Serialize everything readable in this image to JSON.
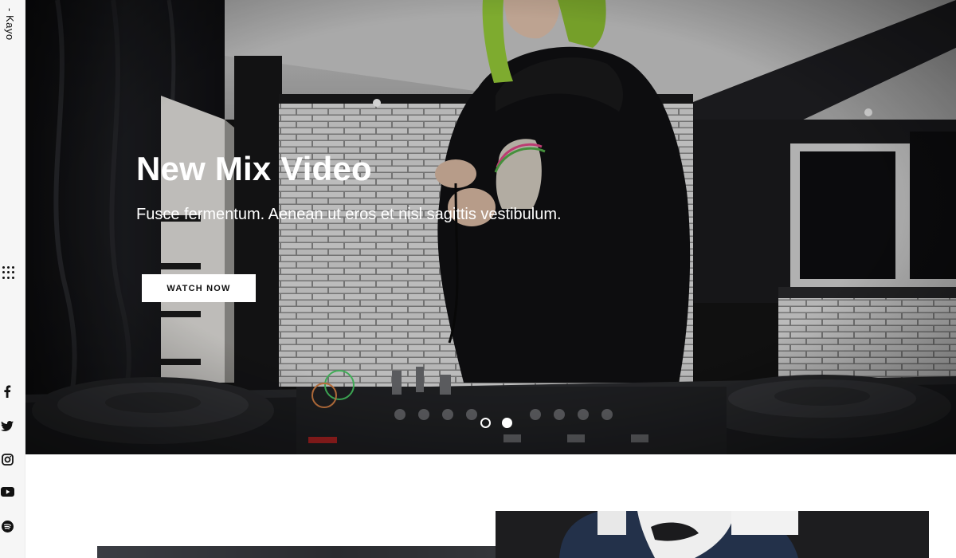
{
  "sidebar": {
    "brand": "- Kayo",
    "menu_icon": "grid-dots-icon",
    "social": [
      {
        "name": "facebook",
        "icon": "facebook-icon"
      },
      {
        "name": "twitter",
        "icon": "twitter-icon"
      },
      {
        "name": "instagram",
        "icon": "instagram-icon"
      },
      {
        "name": "youtube",
        "icon": "youtube-icon"
      },
      {
        "name": "spotify",
        "icon": "spotify-icon"
      }
    ]
  },
  "hero": {
    "title": "New Mix Video",
    "subtitle": "Fusce fermentum. Aenean ut eros et nisl sagittis vestibulum.",
    "button_label": "WATCH NOW",
    "slides": 2,
    "active_slide": 2
  },
  "colors": {
    "accent_hair": "#9ad13a",
    "text_dark": "#111111",
    "sidebar_bg": "#f6f6f6"
  }
}
